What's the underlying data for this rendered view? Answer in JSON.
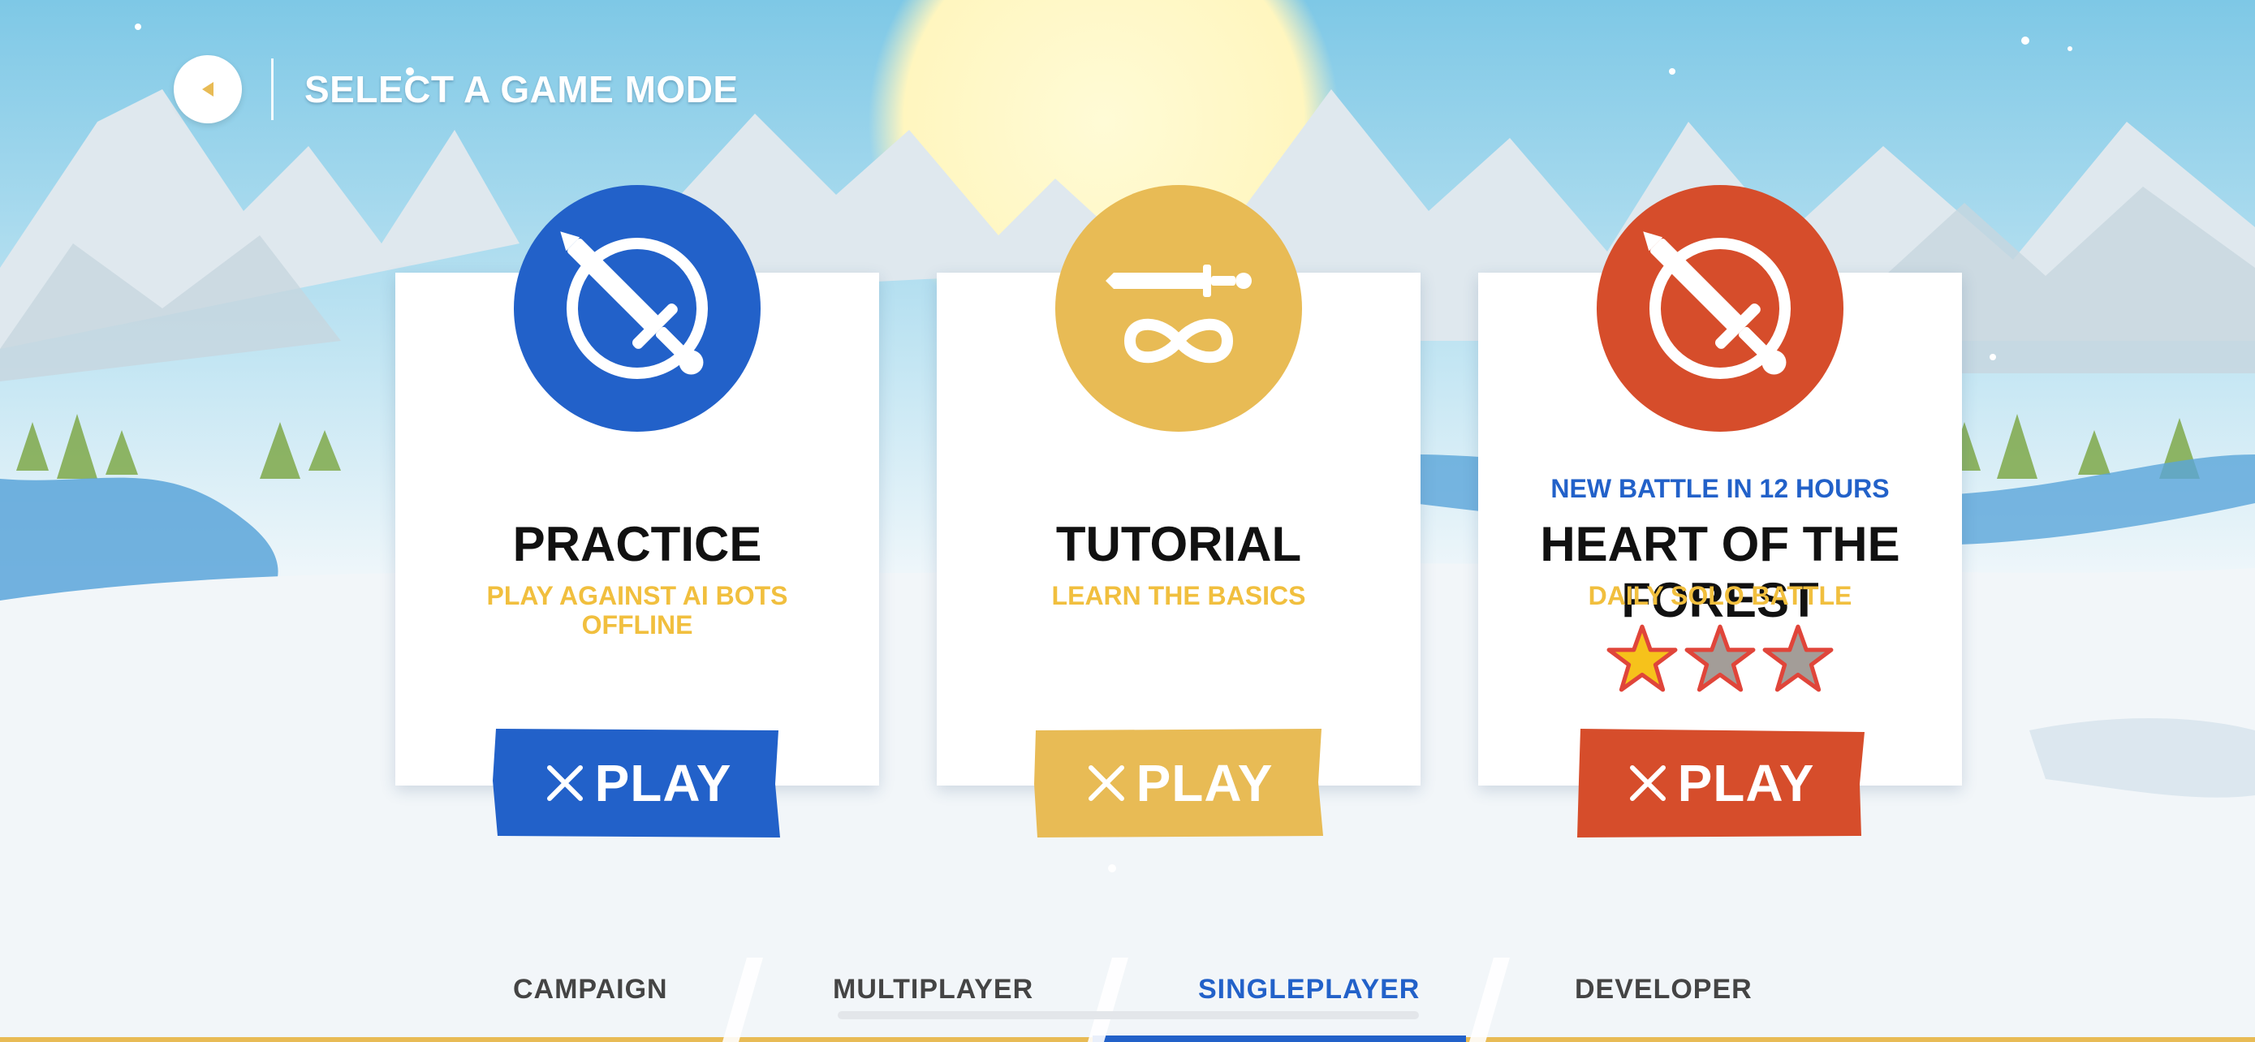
{
  "header": {
    "title": "SELECT A GAME MODE"
  },
  "colors": {
    "blue": "#2261c9",
    "yellow": "#e8bb55",
    "red": "#d64d2b",
    "subtitle": "#f1bf3e"
  },
  "modes": [
    {
      "name": "PRACTICE",
      "subtitle": "PLAY AGAINST AI BOTS OFFLINE",
      "play_label": "PLAY",
      "icon": "sword-circle-icon"
    },
    {
      "name": "TUTORIAL",
      "subtitle": "LEARN THE BASICS",
      "play_label": "PLAY",
      "icon": "sword-infinity-icon"
    },
    {
      "name": "HEART OF THE FOREST",
      "note": "NEW BATTLE IN 12  HOURS",
      "subtitle": "DAILY SOLO BATTLE",
      "play_label": "PLAY",
      "icon": "sword-circle-icon",
      "stars_earned": 1,
      "stars_total": 3
    }
  ],
  "tabs": [
    {
      "label": "CAMPAIGN",
      "active": false
    },
    {
      "label": "MULTIPLAYER",
      "active": false
    },
    {
      "label": "SINGLEPLAYER",
      "active": true
    },
    {
      "label": "DEVELOPER",
      "active": false
    }
  ]
}
